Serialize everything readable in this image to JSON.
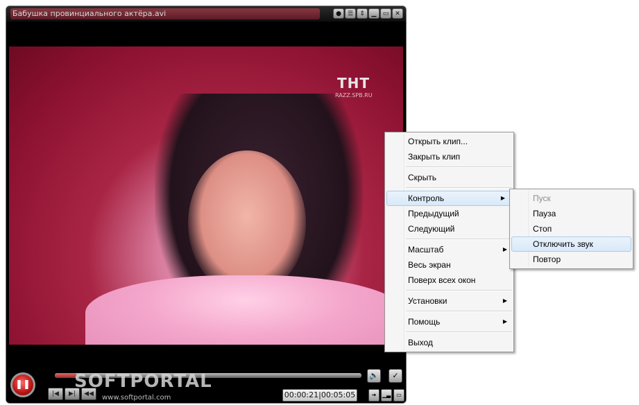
{
  "window": {
    "title": "Бабушка провинциального актёра.avi"
  },
  "video": {
    "channel_logo": "ТНТ",
    "channel_site": "RAZZ.SPB.RU"
  },
  "controls": {
    "progress_fraction": 0.07,
    "time_text": "00:00:21|00:05:05",
    "watermark": "SOFTPORTAL",
    "watermark_url": "www.softportal.com"
  },
  "context_menu": {
    "items": [
      {
        "label": "Открыть клип..."
      },
      {
        "label": "Закрыть клип"
      },
      {
        "label": "Скрыть"
      },
      {
        "label": "Контроль"
      },
      {
        "label": "Предыдущий"
      },
      {
        "label": "Следующий"
      },
      {
        "label": "Масштаб"
      },
      {
        "label": "Весь экран"
      },
      {
        "label": "Поверх всех окон"
      },
      {
        "label": "Установки"
      },
      {
        "label": "Помощь"
      },
      {
        "label": "Выход"
      }
    ]
  },
  "submenu": {
    "items": [
      {
        "label": "Пуск"
      },
      {
        "label": "Пауза"
      },
      {
        "label": "Стоп"
      },
      {
        "label": "Отключить звук"
      },
      {
        "label": "Повтор"
      }
    ]
  },
  "colors": {
    "menu_background": "#f5f5f5",
    "menu_highlight": "#d8e9f9",
    "title_accent": "#a23a48",
    "play_button": "#c21818"
  }
}
